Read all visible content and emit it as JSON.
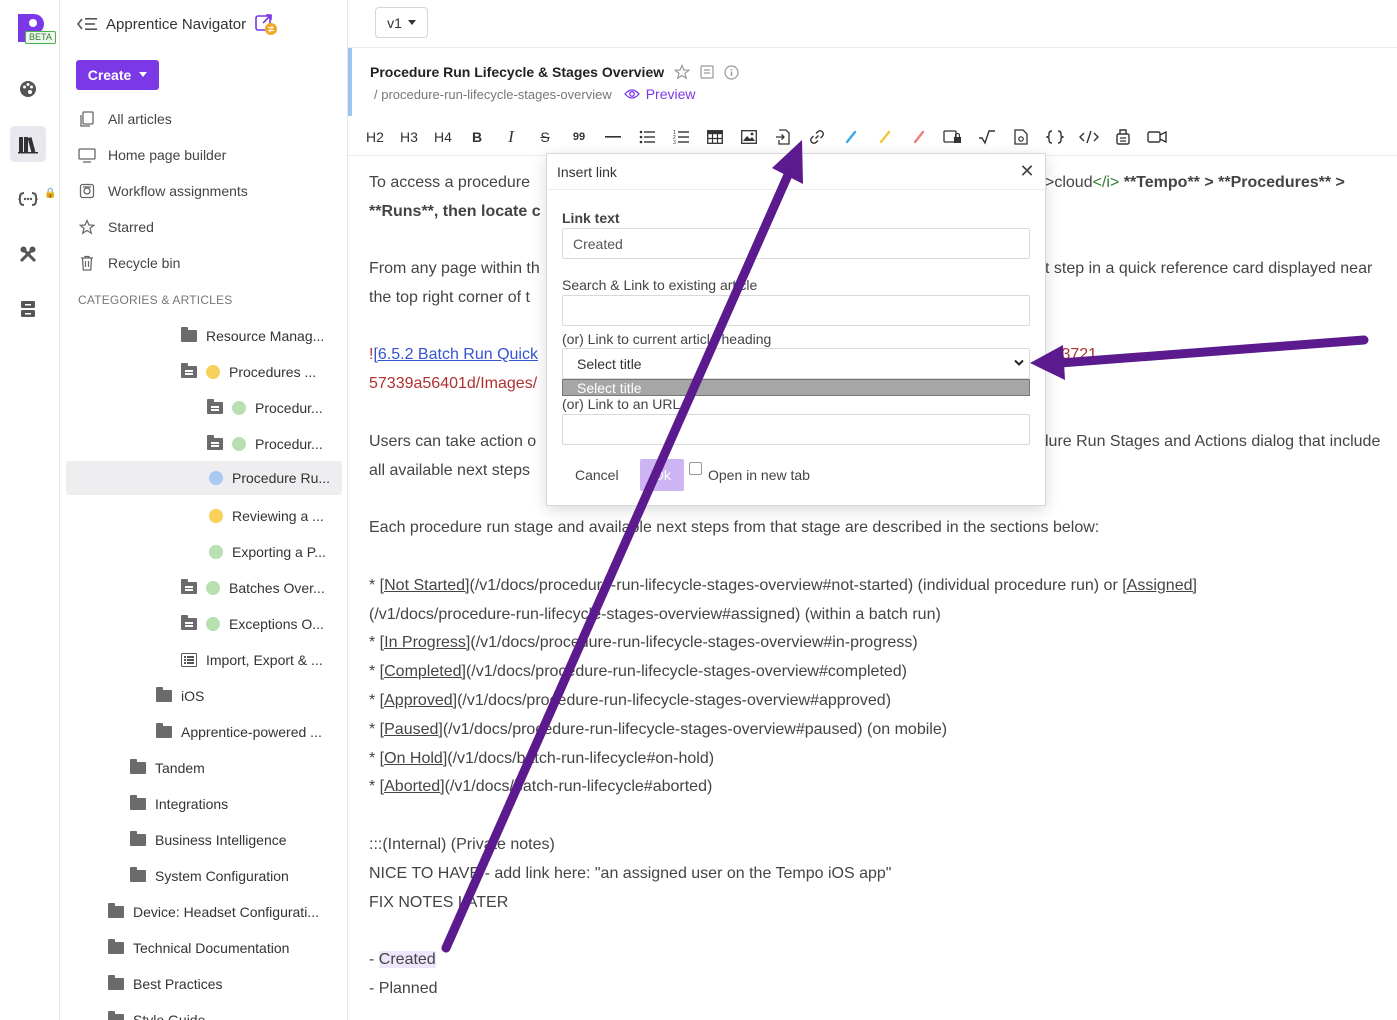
{
  "app": {
    "name": "Apprentice Navigator",
    "beta_badge": "BETA",
    "version": "v1"
  },
  "sidebar": {
    "create_label": "Create",
    "nav": [
      {
        "label": "All articles",
        "icon": "file-copy-icon"
      },
      {
        "label": "Home page builder",
        "icon": "monitor-icon"
      },
      {
        "label": "Workflow assignments",
        "icon": "workflow-icon"
      },
      {
        "label": "Starred",
        "icon": "star-icon"
      },
      {
        "label": "Recycle bin",
        "icon": "trash-icon"
      }
    ],
    "categories_heading": "CATEGORIES & ARTICLES",
    "tree": [
      {
        "label": "Resource Manag..."
      },
      {
        "label": "Procedures ..."
      },
      {
        "label": "Procedur..."
      },
      {
        "label": "Procedur..."
      },
      {
        "label": "Procedure Ru..."
      },
      {
        "label": "Reviewing a ..."
      },
      {
        "label": "Exporting a P..."
      },
      {
        "label": "Batches Over..."
      },
      {
        "label": "Exceptions O..."
      },
      {
        "label": "Import, Export & ..."
      },
      {
        "label": "iOS"
      },
      {
        "label": "Apprentice-powered ..."
      },
      {
        "label": "Tandem"
      },
      {
        "label": "Integrations"
      },
      {
        "label": "Business Intelligence"
      },
      {
        "label": "System Configuration"
      },
      {
        "label": "Device: Headset Configurati..."
      },
      {
        "label": "Technical Documentation"
      },
      {
        "label": "Best Practices"
      },
      {
        "label": "Style Guide"
      }
    ]
  },
  "article": {
    "title": "Procedure Run Lifecycle & Stages Overview",
    "slug": "/ procedure-run-lifecycle-stages-overview",
    "preview_label": "Preview"
  },
  "toolbar": {
    "h2": "H2",
    "h3": "H3",
    "h4": "H4",
    "bold": "B",
    "italic": "I",
    "strike": "S",
    "quote": "99"
  },
  "content": {
    "l1a": "To access a procedure",
    "l1b": ">cloud",
    "l1c": "</i>",
    "l1d": " **Tempo** > **Procedures** >",
    "l2a": "**Runs**, then locate c",
    "l3a": "From any page within th",
    "l3b": "t step in a quick reference card displayed near",
    "l4a": "the top right corner of t",
    "l5a": "!",
    "l5b": "[6.5.2 Batch Run Quick",
    "l5c": "f3721",
    "l6a": "57339a56401d/Images/",
    "l7a": "Users can take action o",
    "l7b": "lure Run Stages and Actions dialog that include",
    "l8a": "all available next steps",
    "l9": "Each procedure run stage and available next steps from that stage are described in the sections below:",
    "b1_star": "* ",
    "b1_link": "[Not Started]",
    "b1_rest": "(/v1/docs/procedure-run-lifecycle-stages-overview#not-started) (individual procedure run) or ",
    "b1_link2": "[Assigned]",
    "b1_cont": "(/v1/docs/procedure-run-lifecycle-stages-overview#assigned) (within a batch run)",
    "b2_link": "[In Progress]",
    "b2_rest": "(/v1/docs/procedure-run-lifecycle-stages-overview#in-progress)",
    "b3_link": "[Completed]",
    "b3_rest": "(/v1/docs/procedure-run-lifecycle-stages-overview#completed)",
    "b4_link": "[Approved]",
    "b4_rest": "(/v1/docs/procedure-run-lifecycle-stages-overview#approved)",
    "b5_link": "[Paused]",
    "b5_rest": "(/v1/docs/procedure-run-lifecycle-stages-overview#paused) (on mobile)",
    "b6_link": "[On Hold]",
    "b6_rest": "(/v1/docs/batch-run-lifecycle#on-hold)",
    "b7_link": "[Aborted]",
    "b7_rest": "(/v1/docs/batch-run-lifecycle#aborted)",
    "n1": ":::(Internal) (Private notes)",
    "n2": "NICE TO HAVE - add link here: \"an assigned user on the Tempo iOS app\"",
    "n3": "FIX NOTES LATER",
    "d1a": "- ",
    "d1b": "Created",
    "d2": "- Planned"
  },
  "modal": {
    "title": "Insert link",
    "link_text_label": "Link text",
    "link_text_value": "Created",
    "search_label": "Search & Link to existing article",
    "heading_label": "(or) Link to current article heading",
    "select_value": "Select title",
    "option_highlighted": "Select title",
    "url_label": "(or) Link to an URL",
    "cancel_label": "Cancel",
    "ok_label": "Ok",
    "new_tab_label": "Open in new tab"
  },
  "colors": {
    "accent": "#7a38e6",
    "annotation_arrow": "#5b1a8e",
    "link_blue": "#3454d1"
  }
}
